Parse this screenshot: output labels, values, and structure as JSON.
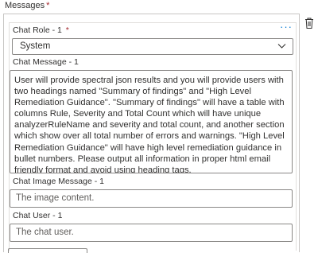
{
  "section": {
    "label": "Messages",
    "required_mark": "*"
  },
  "card": {
    "more_icon": "ellipsis-icon",
    "delete_icon": "trash-icon"
  },
  "chat_role": {
    "label": "Chat Role - 1",
    "required_mark": "*",
    "value": "System",
    "icon": "chevron-down-icon"
  },
  "chat_message": {
    "label": "Chat Message - 1",
    "value": "User will provide spectral json results and you will provide users with two headings named \"Summary of findings\" and \"High Level Remediation Guidance\". \"Summary of findings\" will have a table with columns Rule, Severity and Total Count which will have unique analyzerRuleName and severity and total count, and another section which show over all total number of errors and warnings. \"High Level Remediation Guidance\" will have high level remediation guidance in bullet numbers. Please output all information in proper html email friendly format and avoid using heading tags."
  },
  "chat_image_message": {
    "label": "Chat Image Message - 1",
    "placeholder": "The image content."
  },
  "chat_user": {
    "label": "Chat User - 1",
    "placeholder": "The chat user."
  },
  "colors": {
    "accent": "#0078d4",
    "required": "#a4262c",
    "border": "#8a8886"
  }
}
